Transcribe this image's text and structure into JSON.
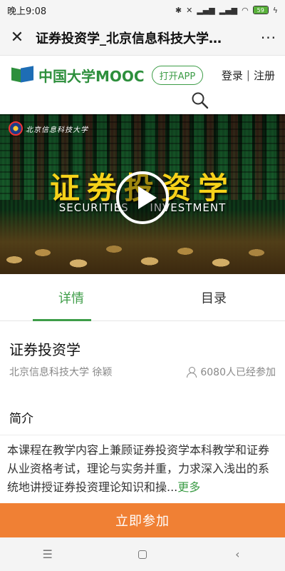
{
  "status_bar": {
    "time": "晚上9:08",
    "battery": "59"
  },
  "title_bar": {
    "title": "证券投资学_北京信息科技大学…",
    "close_icon": "close-icon",
    "more_icon": "more-icon"
  },
  "header": {
    "logo_text": "中国大学MOOC",
    "open_app": "打开APP",
    "login": "登录",
    "separator": "|",
    "register": "注册"
  },
  "video": {
    "school_name": "北京信息科技大学",
    "main_title": "证券投资学",
    "sub_title": "SECURITIES INVESTMENT"
  },
  "tabs": [
    {
      "label": "详情",
      "active": true
    },
    {
      "label": "目录",
      "active": false
    }
  ],
  "course": {
    "title": "证券投资学",
    "school_teacher": "北京信息科技大学 徐颖",
    "participants": "6080人已经参加"
  },
  "intro": {
    "heading": "简介",
    "text": "本课程在教学内容上兼顾证券投资学本科教学和证券从业资格考试，理论与实务并重，力求深入浅出的系统地讲授证券投资理论知识和操...",
    "more": "更多"
  },
  "join_button": "立即参加",
  "nav": {
    "menu": "☰",
    "home": "",
    "back": "‹"
  },
  "colors": {
    "accent": "#3e9d48",
    "join": "#f08034"
  }
}
